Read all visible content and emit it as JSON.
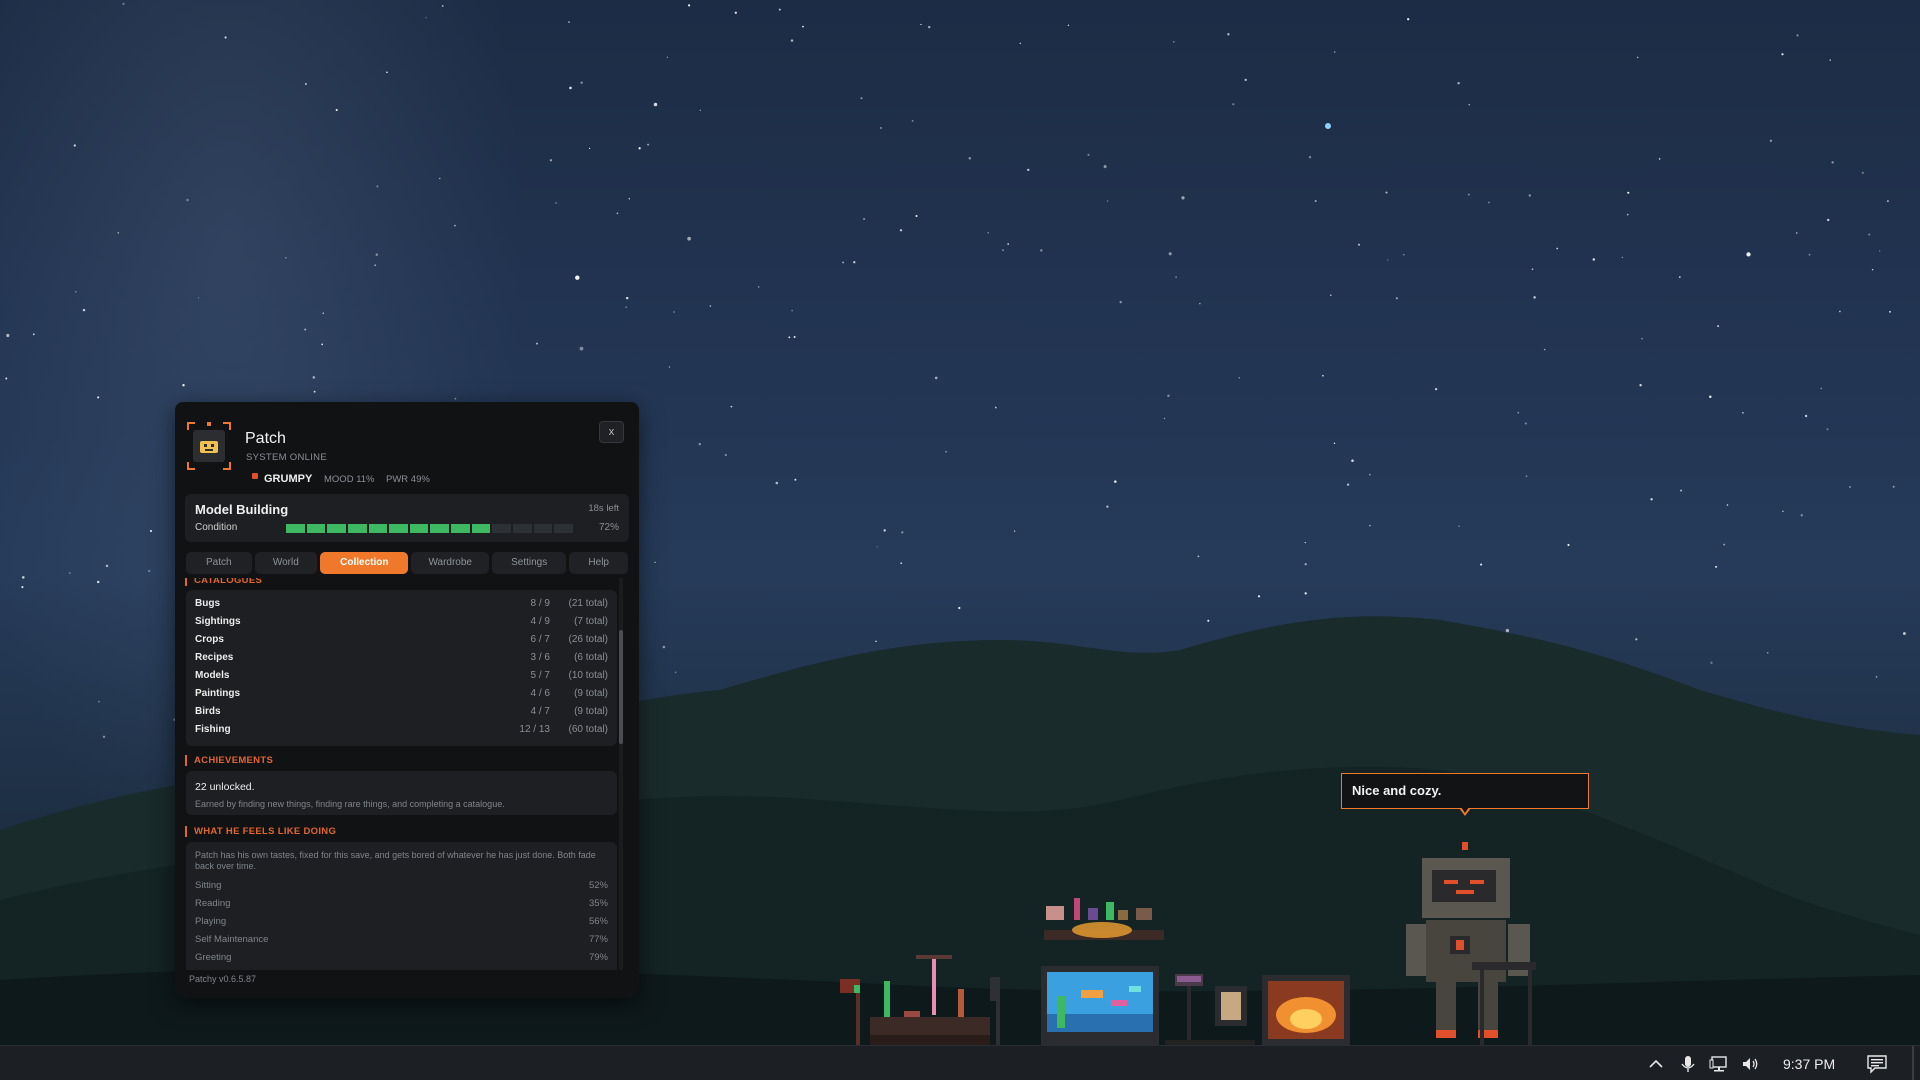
{
  "panel": {
    "name": "Patch",
    "status": "SYSTEM ONLINE",
    "mood_word": "GRUMPY",
    "mood_stat": "MOOD 11%",
    "power_stat": "PWR 49%",
    "close_label": "x"
  },
  "activity": {
    "title": "Model Building",
    "time_left": "18s left",
    "condition_label": "Condition",
    "condition_value": 0.72,
    "condition_pct": "72%"
  },
  "tabs": [
    {
      "label": "Patch",
      "active": false
    },
    {
      "label": "World",
      "active": false
    },
    {
      "label": "Collection",
      "active": true
    },
    {
      "label": "Wardrobe",
      "active": false
    },
    {
      "label": "Settings",
      "active": false
    },
    {
      "label": "Help",
      "active": false
    }
  ],
  "catalogues": {
    "heading": "CATALOGUES",
    "rows": [
      {
        "name": "Bugs",
        "count": "8 / 9",
        "total": "(21 total)"
      },
      {
        "name": "Sightings",
        "count": "4 / 9",
        "total": "(7 total)"
      },
      {
        "name": "Crops",
        "count": "6 / 7",
        "total": "(26 total)"
      },
      {
        "name": "Recipes",
        "count": "3 / 6",
        "total": "(6 total)"
      },
      {
        "name": "Models",
        "count": "5 / 7",
        "total": "(10 total)"
      },
      {
        "name": "Paintings",
        "count": "4 / 6",
        "total": "(9 total)"
      },
      {
        "name": "Birds",
        "count": "4 / 7",
        "total": "(9 total)"
      },
      {
        "name": "Fishing",
        "count": "12 / 13",
        "total": "(60 total)"
      }
    ]
  },
  "achievements": {
    "heading": "ACHIEVEMENTS",
    "count_text": "22 unlocked.",
    "description": "Earned by finding new things, finding rare things, and completing a catalogue."
  },
  "feels": {
    "heading": "WHAT HE FEELS LIKE DOING",
    "description": "Patch has his own tastes, fixed for this save, and gets bored of whatever he has just done. Both fade back over time.",
    "rows": [
      {
        "name": "Sitting",
        "value": "52%"
      },
      {
        "name": "Reading",
        "value": "35%"
      },
      {
        "name": "Playing",
        "value": "56%"
      },
      {
        "name": "Self Maintenance",
        "value": "77%"
      },
      {
        "name": "Greeting",
        "value": "79%"
      }
    ]
  },
  "version": "Patchy v0.6.5.87",
  "speech": "Nice and cozy.",
  "taskbar": {
    "clock": "9:37 PM",
    "icons": [
      "chevron-up-icon",
      "microphone-icon",
      "network-icon",
      "volume-icon",
      "notification-icon"
    ]
  },
  "colors": {
    "accent": "#f0782a",
    "section": "#e2662c",
    "condition_on": "#3fb862",
    "status_dot": "#e2502b"
  }
}
